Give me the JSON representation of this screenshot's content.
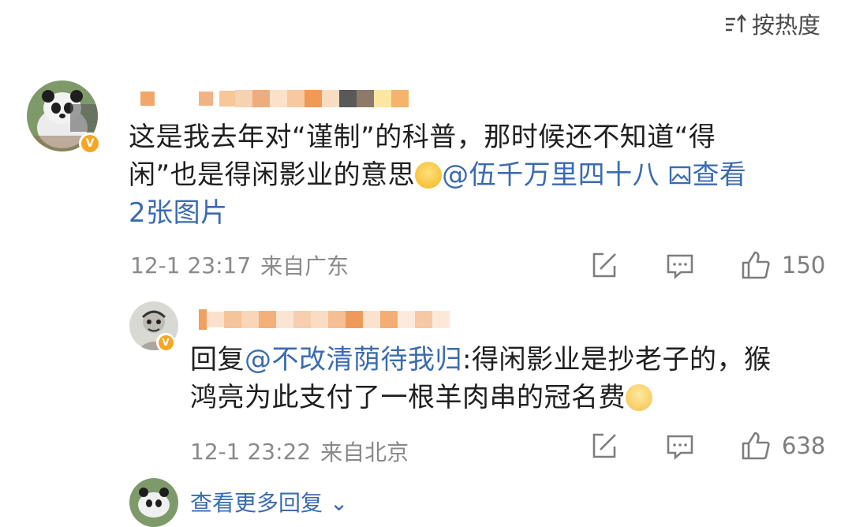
{
  "sort": {
    "label": "按热度",
    "icon": "sort-icon"
  },
  "comment1": {
    "text_plain_1": "这是我去年对“谨制”的科普，那时候还不知道“得",
    "text_plain_2": "闲”也是得闲影业的意思",
    "emoji": "grin-emoji",
    "mention": "@伍千万里四十八",
    "view_images": "查看",
    "view_images_2": "2张图片",
    "time": "12-1 23:17",
    "location": "来自广东",
    "likes": "150",
    "icons": [
      "share-icon",
      "comment-icon",
      "like-icon"
    ]
  },
  "reply1": {
    "prefix": "回复",
    "mention": "@不改清荫待我归",
    "text_1": ":得闲影业是抄老子的，猴",
    "text_2": "鸿亮为此支付了一根羊肉串的冠名费",
    "emoji": "shush-emoji",
    "time": "12-1 23:22",
    "location": "来自北京",
    "likes": "638"
  },
  "more_replies": {
    "label": "查看更多回复"
  },
  "colors": {
    "link": "#3a6bb0",
    "badge": "#f5a623",
    "meta": "#8a8a8a"
  }
}
